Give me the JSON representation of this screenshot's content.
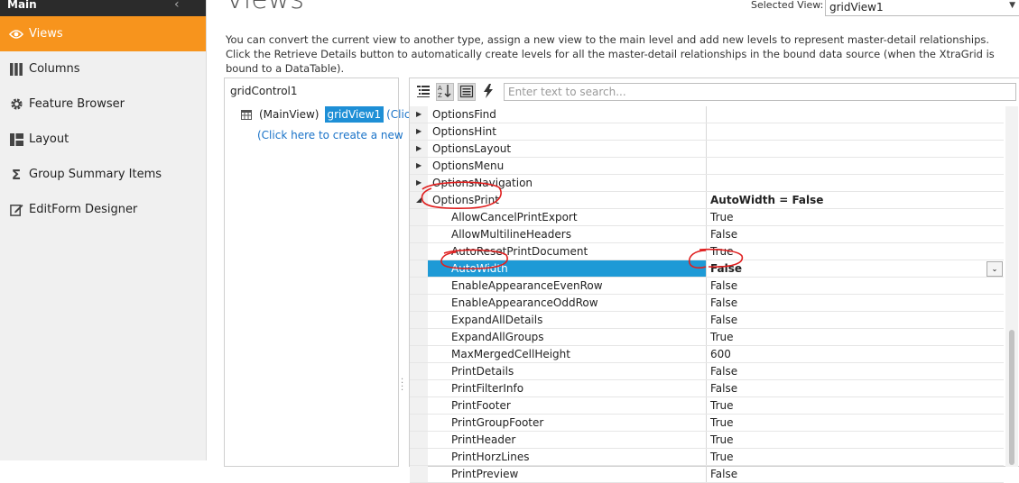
{
  "sidebar": {
    "header": {
      "title": "Main",
      "collapse_icon": "chevron-left-icon"
    },
    "items": [
      {
        "label": "Views",
        "icon": "eye-icon",
        "active": true
      },
      {
        "label": "Columns",
        "icon": "columns-icon"
      },
      {
        "label": "Feature Browser",
        "icon": "gear-icon"
      },
      {
        "label": "Layout",
        "icon": "layout-icon"
      },
      {
        "label": "Group Summary Items",
        "icon": "sigma-icon"
      },
      {
        "label": "EditForm Designer",
        "icon": "edit-form-icon"
      }
    ],
    "accent_color": "#f7941d"
  },
  "main": {
    "title": "Views",
    "selected_view_label": "Selected View:",
    "selected_view_value": "gridView1",
    "description": "You can convert the current view to another type, assign a new view to the main level and add new levels to represent master-detail relationships. Click the Retrieve Details button to automatically create levels for all the master-detail relationships in the bound data source (when the XtraGrid is bound to a DataTable)."
  },
  "tree": {
    "root": "gridControl1",
    "main_view_label": "(MainView)",
    "selected_view": "gridView1",
    "click_link": "(Clic",
    "create_new_link": "(Click here to create a new"
  },
  "property_grid": {
    "search_placeholder": "Enter text to search...",
    "rows": [
      {
        "name": "OptionsFind",
        "value": "",
        "expander": "collapsed"
      },
      {
        "name": "OptionsHint",
        "value": "",
        "expander": "collapsed"
      },
      {
        "name": "OptionsLayout",
        "value": "",
        "expander": "collapsed"
      },
      {
        "name": "OptionsMenu",
        "value": "",
        "expander": "collapsed"
      },
      {
        "name": "OptionsNavigation",
        "value": "",
        "expander": "collapsed"
      },
      {
        "name": "OptionsPrint",
        "value": "AutoWidth = False",
        "expander": "expanded"
      },
      {
        "name": "AllowCancelPrintExport",
        "value": "True",
        "child": true
      },
      {
        "name": "AllowMultilineHeaders",
        "value": "False",
        "child": true
      },
      {
        "name": "AutoResetPrintDocument",
        "value": "True",
        "child": true
      },
      {
        "name": "AutoWidth",
        "value": "False",
        "child": true,
        "selected": true
      },
      {
        "name": "EnableAppearanceEvenRow",
        "value": "False",
        "child": true
      },
      {
        "name": "EnableAppearanceOddRow",
        "value": "False",
        "child": true
      },
      {
        "name": "ExpandAllDetails",
        "value": "False",
        "child": true
      },
      {
        "name": "ExpandAllGroups",
        "value": "True",
        "child": true
      },
      {
        "name": "MaxMergedCellHeight",
        "value": "600",
        "child": true
      },
      {
        "name": "PrintDetails",
        "value": "False",
        "child": true
      },
      {
        "name": "PrintFilterInfo",
        "value": "False",
        "child": true
      },
      {
        "name": "PrintFooter",
        "value": "True",
        "child": true
      },
      {
        "name": "PrintGroupFooter",
        "value": "True",
        "child": true
      },
      {
        "name": "PrintHeader",
        "value": "True",
        "child": true
      },
      {
        "name": "PrintHorzLines",
        "value": "True",
        "child": true
      },
      {
        "name": "PrintPreview",
        "value": "False",
        "child": true
      }
    ],
    "selection_color": "#1e9ad6"
  },
  "annotation_color": "#e02020"
}
